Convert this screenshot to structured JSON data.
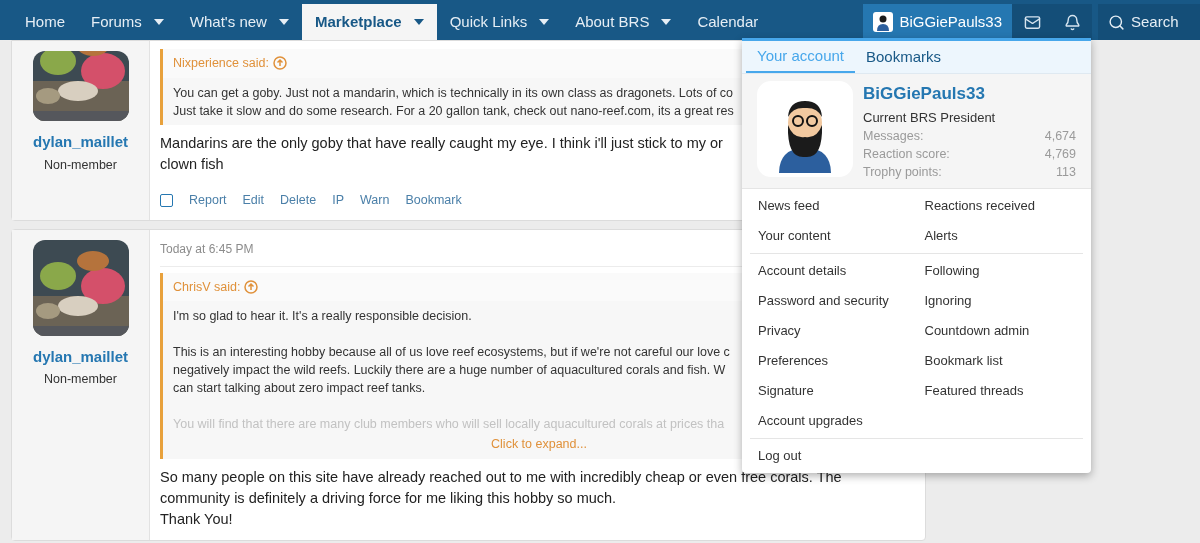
{
  "nav": {
    "items": [
      {
        "label": "Home",
        "caret": false,
        "selected": false
      },
      {
        "label": "Forums",
        "caret": true,
        "selected": false
      },
      {
        "label": "What's new",
        "caret": true,
        "selected": false
      },
      {
        "label": "Marketplace",
        "caret": true,
        "selected": true
      },
      {
        "label": "Quick Links",
        "caret": true,
        "selected": false
      },
      {
        "label": "About BRS",
        "caret": true,
        "selected": false
      },
      {
        "label": "Calendar",
        "caret": false,
        "selected": false
      }
    ],
    "user": {
      "name": "BiGGiePauls33",
      "selected": true
    },
    "search": {
      "label": "Search"
    }
  },
  "posts": [
    {
      "author": "dylan_maillet",
      "role": "Non-member",
      "quote": {
        "author": "Nixperience said:",
        "paragraphs": [
          {
            "lines": [
              "You can get a goby. Just not a mandarin, which is technically in its own class as dragonets. Lots of co",
              "Just take it slow and do some research. For a 20 gallon tank, check out nano-reef.com, its a great res"
            ],
            "faded": false
          }
        ]
      },
      "body": [
        "Mandarins are the only goby that have really caught my eye. I think i'll just stick to my or",
        "clown fish"
      ],
      "select": {
        "checked": false
      },
      "actions": [
        "Report",
        "Edit",
        "Delete",
        "IP",
        "Warn",
        "Bookmark"
      ]
    },
    {
      "author": "dylan_maillet",
      "role": "Non-member",
      "timestamp": "Today at 6:45 PM",
      "quote": {
        "author": "ChrisV said:",
        "paragraphs": [
          {
            "lines": [
              "I'm so glad to hear it. It's a really responsible decision."
            ],
            "faded": false
          },
          {
            "lines": [
              "This is an interesting hobby because all of us love reef ecosystems, but if we're not careful our love c",
              "negatively impact the wild reefs. Luckily there are a huge number of aquacultured corals and fish. W",
              "can start talking about zero impact reef tanks."
            ],
            "faded": false
          },
          {
            "lines": [
              "You will find that there are many club members who will sell locally aquacultured corals at prices tha"
            ],
            "faded": true
          }
        ],
        "expand": "Click to expand..."
      },
      "body": [
        "So many people on this site have already reached out to me with incredibly cheap or even free corals. The",
        "community is definitely a driving force for me liking this hobby so much.",
        "Thank You!"
      ]
    }
  ],
  "account_menu": {
    "tabs": [
      {
        "label": "Your account",
        "selected": true
      },
      {
        "label": "Bookmarks",
        "selected": false
      }
    ],
    "profile": {
      "name": "BiGGiePauls33",
      "title": "Current BRS President",
      "stats": [
        {
          "label": "Messages:",
          "value": "4,674"
        },
        {
          "label": "Reaction score:",
          "value": "4,769"
        },
        {
          "label": "Trophy points:",
          "value": "113"
        }
      ]
    },
    "groups": [
      [
        {
          "label": "News feed"
        },
        {
          "label": "Reactions received"
        },
        {
          "label": "Your content"
        },
        {
          "label": "Alerts"
        }
      ],
      [
        {
          "label": "Account details"
        },
        {
          "label": "Following"
        },
        {
          "label": "Password and security"
        },
        {
          "label": "Ignoring"
        },
        {
          "label": "Privacy"
        },
        {
          "label": "Countdown admin"
        },
        {
          "label": "Preferences"
        },
        {
          "label": "Bookmark list"
        },
        {
          "label": "Signature"
        },
        {
          "label": "Featured threads"
        },
        {
          "label": "Account upgrades"
        }
      ],
      [
        {
          "label": "Log out"
        }
      ]
    ]
  }
}
